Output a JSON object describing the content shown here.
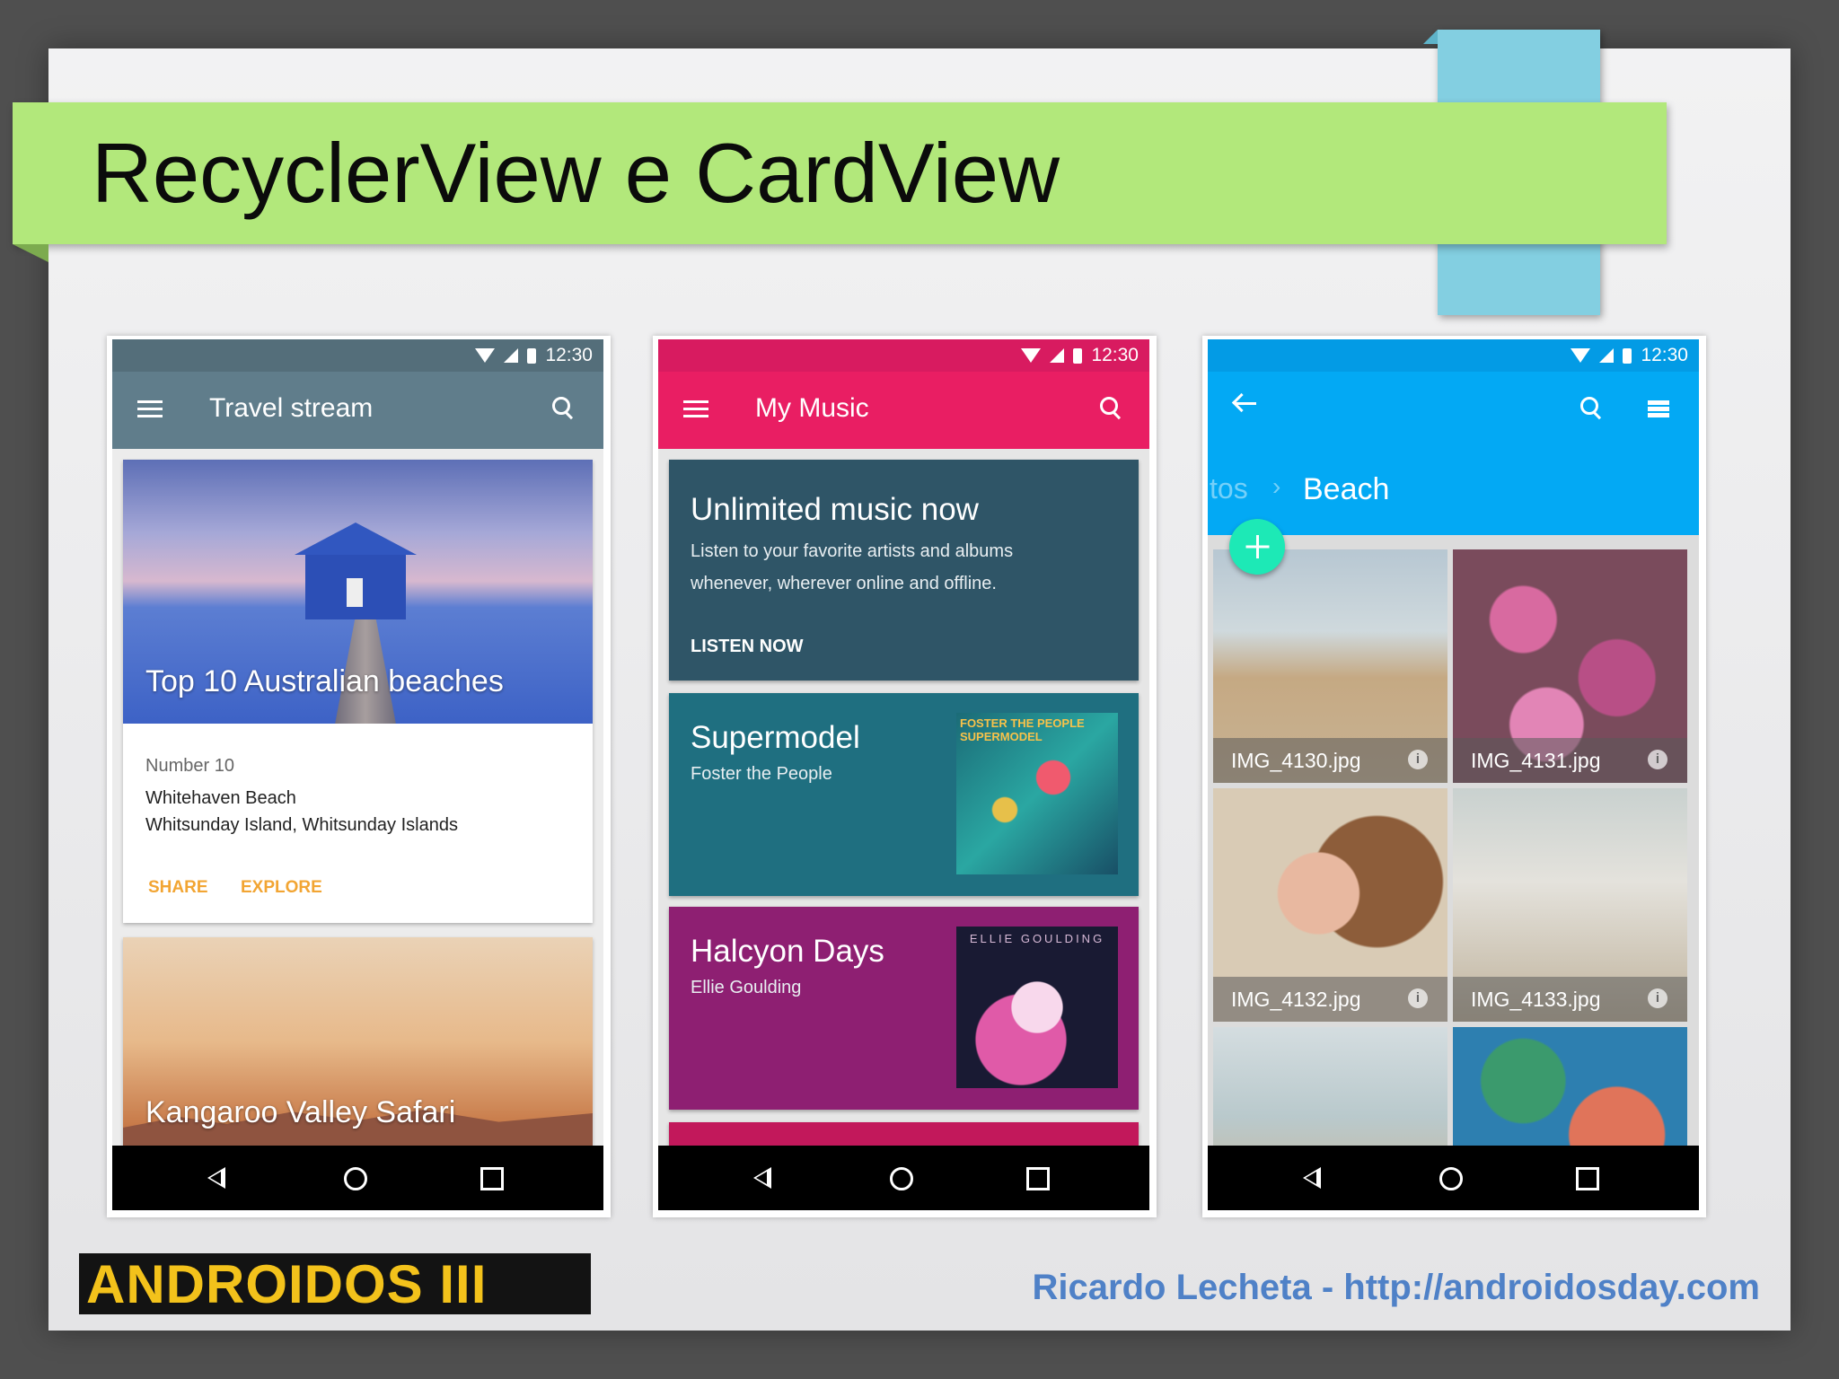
{
  "slide": {
    "title": "RecyclerView e CardView",
    "logo": "ANDROIDOS III",
    "footer": "Ricardo Lecheta - http://androidosday.com"
  },
  "phones": {
    "travel": {
      "time": "12:30",
      "toolbar_title": "Travel stream",
      "card1": {
        "image_caption": "Top 10 Australian beaches",
        "number": "Number 10",
        "place": "Whitehaven Beach",
        "location": "Whitsunday Island, Whitsunday Islands",
        "actions": [
          "SHARE",
          "EXPLORE"
        ]
      },
      "card2": {
        "image_caption": "Kangaroo Valley Safari"
      }
    },
    "music": {
      "time": "12:30",
      "toolbar_title": "My Music",
      "promo": {
        "title": "Unlimited music now",
        "line1": "Listen to your favorite artists and albums",
        "line2": "whenever, wherever online and offline.",
        "action": "LISTEN NOW"
      },
      "albums": [
        {
          "title": "Supermodel",
          "artist": "Foster the People",
          "cover_text": "FOSTER THE PEOPLE SUPERMODEL"
        },
        {
          "title": "Halcyon Days",
          "artist": "Ellie Goulding",
          "cover_text": "ELLIE GOULDING"
        }
      ]
    },
    "gallery": {
      "time": "12:30",
      "breadcrumb_prev": "tos",
      "breadcrumb_sep": "›",
      "breadcrumb_current": "Beach",
      "photos": [
        "IMG_4130.jpg",
        "IMG_4131.jpg",
        "IMG_4132.jpg",
        "IMG_4133.jpg"
      ],
      "info_glyph": "i"
    }
  },
  "colors": {
    "title_band": "#b2e87b",
    "travel_toolbar": "#607d8b",
    "music_toolbar": "#e91e63",
    "gallery_toolbar": "#03a9f4",
    "fab": "#1de9b6",
    "action_text": "#f2a533",
    "footer_text": "#4f81c7"
  }
}
